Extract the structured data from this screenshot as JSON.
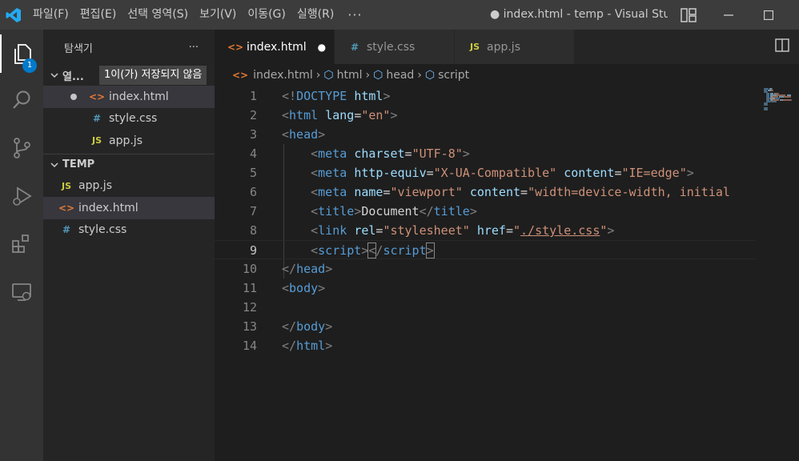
{
  "titlebar": {
    "menu": [
      "파일(F)",
      "편집(E)",
      "선택 영역(S)",
      "보기(V)",
      "이동(G)",
      "실행(R)"
    ],
    "more": "···",
    "window_title": "● index.html - temp - Visual Stu..."
  },
  "activity": {
    "icons": [
      "files-icon",
      "search-icon",
      "source-control-icon",
      "run-debug-icon",
      "extensions-icon",
      "remote-explorer-icon"
    ],
    "badge": "1"
  },
  "sidebar": {
    "title": "탐색기",
    "more": "···",
    "open_editors_label": "열...",
    "tooltip": "1이(가) 저장되지 않음",
    "open_editors": [
      {
        "name": "index.html",
        "icon": "<>",
        "type": "html",
        "modified": true
      },
      {
        "name": "style.css",
        "icon": "#",
        "type": "css",
        "modified": false
      },
      {
        "name": "app.js",
        "icon": "JS",
        "type": "js",
        "modified": false
      }
    ],
    "folder_label": "TEMP",
    "folder_items": [
      {
        "name": "app.js",
        "icon": "JS",
        "type": "js"
      },
      {
        "name": "index.html",
        "icon": "<>",
        "type": "html"
      },
      {
        "name": "style.css",
        "icon": "#",
        "type": "css"
      }
    ]
  },
  "tabs": [
    {
      "label": "index.html",
      "icon": "<>",
      "type": "html",
      "active": true,
      "modified_dot": "●"
    },
    {
      "label": "style.css",
      "icon": "#",
      "type": "css",
      "active": false
    },
    {
      "label": "app.js",
      "icon": "JS",
      "type": "js",
      "active": false
    }
  ],
  "breadcrumb": [
    {
      "label": "index.html",
      "icon": "<>"
    },
    {
      "label": "html",
      "icon": "⬡"
    },
    {
      "label": "head",
      "icon": "⬡"
    },
    {
      "label": "script",
      "icon": "⬡"
    }
  ],
  "editor": {
    "current_line": 9,
    "lines": [
      {
        "n": "1",
        "tokens": [
          [
            "p",
            "<!"
          ],
          [
            "t",
            "DOCTYPE"
          ],
          [
            "x",
            " "
          ],
          [
            "a",
            "html"
          ],
          [
            "p",
            ">"
          ]
        ]
      },
      {
        "n": "2",
        "tokens": [
          [
            "p",
            "<"
          ],
          [
            "t",
            "html"
          ],
          [
            "x",
            " "
          ],
          [
            "a",
            "lang"
          ],
          [
            "x",
            "="
          ],
          [
            "s",
            "\"en\""
          ],
          [
            "p",
            ">"
          ]
        ]
      },
      {
        "n": "3",
        "tokens": [
          [
            "p",
            "<"
          ],
          [
            "t",
            "head"
          ],
          [
            "p",
            ">"
          ]
        ]
      },
      {
        "n": "4",
        "tokens": [
          [
            "x",
            "    "
          ],
          [
            "p",
            "<"
          ],
          [
            "t",
            "meta"
          ],
          [
            "x",
            " "
          ],
          [
            "a",
            "charset"
          ],
          [
            "x",
            "="
          ],
          [
            "s",
            "\"UTF-8\""
          ],
          [
            "p",
            ">"
          ]
        ]
      },
      {
        "n": "5",
        "tokens": [
          [
            "x",
            "    "
          ],
          [
            "p",
            "<"
          ],
          [
            "t",
            "meta"
          ],
          [
            "x",
            " "
          ],
          [
            "a",
            "http-equiv"
          ],
          [
            "x",
            "="
          ],
          [
            "s",
            "\"X-UA-Compatible\""
          ],
          [
            "x",
            " "
          ],
          [
            "a",
            "content"
          ],
          [
            "x",
            "="
          ],
          [
            "s",
            "\"IE=edge\""
          ],
          [
            "p",
            ">"
          ]
        ]
      },
      {
        "n": "6",
        "tokens": [
          [
            "x",
            "    "
          ],
          [
            "p",
            "<"
          ],
          [
            "t",
            "meta"
          ],
          [
            "x",
            " "
          ],
          [
            "a",
            "name"
          ],
          [
            "x",
            "="
          ],
          [
            "s",
            "\"viewport\""
          ],
          [
            "x",
            " "
          ],
          [
            "a",
            "content"
          ],
          [
            "x",
            "="
          ],
          [
            "s",
            "\"width=device-width, initial"
          ]
        ]
      },
      {
        "n": "7",
        "tokens": [
          [
            "x",
            "    "
          ],
          [
            "p",
            "<"
          ],
          [
            "t",
            "title"
          ],
          [
            "p",
            ">"
          ],
          [
            "x",
            "Document"
          ],
          [
            "p",
            "</"
          ],
          [
            "t",
            "title"
          ],
          [
            "p",
            ">"
          ]
        ]
      },
      {
        "n": "8",
        "tokens": [
          [
            "x",
            "    "
          ],
          [
            "p",
            "<"
          ],
          [
            "t",
            "link"
          ],
          [
            "x",
            " "
          ],
          [
            "a",
            "rel"
          ],
          [
            "x",
            "="
          ],
          [
            "s",
            "\"stylesheet\""
          ],
          [
            "x",
            " "
          ],
          [
            "a",
            "href"
          ],
          [
            "x",
            "="
          ],
          [
            "s",
            "\""
          ],
          [
            "su",
            "./style.css"
          ],
          [
            "s",
            "\""
          ],
          [
            "p",
            ">"
          ]
        ]
      },
      {
        "n": "9",
        "tokens": [
          [
            "x",
            "    "
          ],
          [
            "p",
            "<"
          ],
          [
            "t",
            "script"
          ],
          [
            "p",
            ">"
          ],
          [
            "pb",
            "<"
          ],
          [
            "p",
            "/"
          ],
          [
            "t",
            "script"
          ],
          [
            "pb",
            ">"
          ]
        ]
      },
      {
        "n": "10",
        "tokens": [
          [
            "p",
            "</"
          ],
          [
            "t",
            "head"
          ],
          [
            "p",
            ">"
          ]
        ]
      },
      {
        "n": "11",
        "tokens": [
          [
            "p",
            "<"
          ],
          [
            "t",
            "body"
          ],
          [
            "p",
            ">"
          ]
        ]
      },
      {
        "n": "12",
        "tokens": []
      },
      {
        "n": "13",
        "tokens": [
          [
            "p",
            "</"
          ],
          [
            "t",
            "body"
          ],
          [
            "p",
            ">"
          ]
        ]
      },
      {
        "n": "14",
        "tokens": [
          [
            "p",
            "</"
          ],
          [
            "t",
            "html"
          ],
          [
            "p",
            ">"
          ]
        ]
      }
    ]
  },
  "colors": {
    "tag": "#569cd6",
    "punct": "#808080",
    "attr": "#9cdcfe",
    "string": "#ce9178",
    "accent": "#007acc"
  }
}
